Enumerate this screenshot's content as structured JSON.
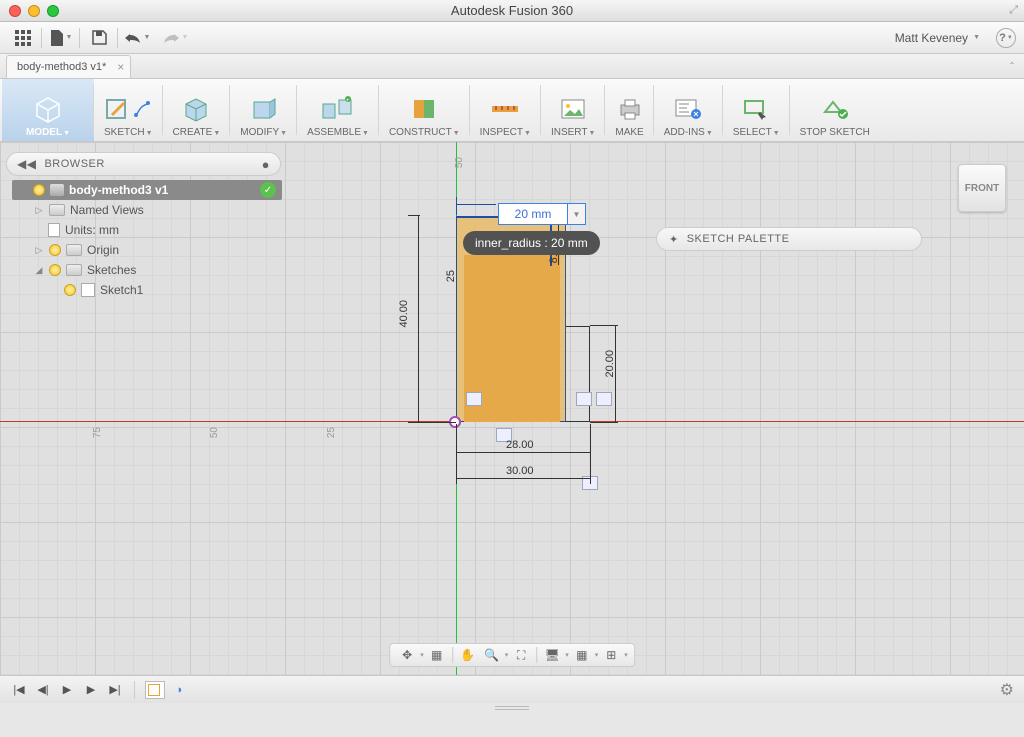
{
  "app": {
    "title": "Autodesk Fusion 360"
  },
  "user_menu": {
    "name": "Matt Keveney"
  },
  "document_tabs": [
    {
      "label": "body-method3 v1*"
    }
  ],
  "ribbon": {
    "workspace": "MODEL",
    "groups": [
      {
        "id": "sketch",
        "label": "SKETCH"
      },
      {
        "id": "create",
        "label": "CREATE"
      },
      {
        "id": "modify",
        "label": "MODIFY"
      },
      {
        "id": "assemble",
        "label": "ASSEMBLE"
      },
      {
        "id": "construct",
        "label": "CONSTRUCT"
      },
      {
        "id": "inspect",
        "label": "INSPECT"
      },
      {
        "id": "insert",
        "label": "INSERT"
      },
      {
        "id": "make",
        "label": "MAKE"
      },
      {
        "id": "addins",
        "label": "ADD-INS"
      },
      {
        "id": "select",
        "label": "SELECT"
      },
      {
        "id": "stopsketch",
        "label": "STOP SKETCH"
      }
    ]
  },
  "browser": {
    "title": "BROWSER",
    "root": "body-method3 v1",
    "items": [
      {
        "label": "Named Views"
      },
      {
        "label": "Units: mm"
      },
      {
        "label": "Origin"
      },
      {
        "label": "Sketches"
      },
      {
        "label": "Sketch1"
      }
    ]
  },
  "sketch_palette": {
    "title": "SKETCH PALETTE"
  },
  "viewcube": {
    "face": "FRONT"
  },
  "dimension_edit": {
    "value": "20 mm",
    "tooltip": "inner_radius : 20 mm"
  },
  "dimensions": {
    "top_ruler": "50",
    "left_height": "40.00",
    "inner_left": "25",
    "inner_right_small": "8.00",
    "right_height": "20.00",
    "bottom_inner": "28.00",
    "bottom_outer": "30.00"
  },
  "ruler_marks": {
    "a": "75",
    "b": "50",
    "c": "25"
  }
}
